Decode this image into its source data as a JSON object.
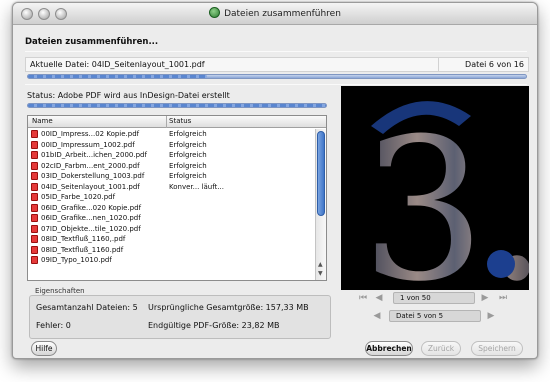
{
  "window": {
    "title": "Dateien zusammenführen"
  },
  "dialog": {
    "heading": "Dateien zusammenführen...",
    "current_file_label": "Aktuelle Datei: 04ID_Seitenlayout_1001.pdf",
    "file_counter": "Datei 6 von 16",
    "file_progress": 0.36,
    "status_text": "Status: Adobe PDF wird aus InDesign-Datei erstellt",
    "status_progress": 1.0
  },
  "list": {
    "col_name": "Name",
    "col_status": "Status",
    "items": [
      {
        "name": "00ID_Impress...02 Kopie.pdf",
        "status": "Erfolgreich"
      },
      {
        "name": "00ID_Impressum_1002.pdf",
        "status": "Erfolgreich"
      },
      {
        "name": "01bID_Arbeit...ichen_2000.pdf",
        "status": "Erfolgreich"
      },
      {
        "name": "02cID_Farbm...ent_2000.pdf",
        "status": "Erfolgreich"
      },
      {
        "name": "03ID_Dokerstellung_1003.pdf",
        "status": "Erfolgreich"
      },
      {
        "name": "04ID_Seitenlayout_1001.pdf",
        "status": "Konver... läuft..."
      },
      {
        "name": "05ID_Farbe_1020.pdf",
        "status": ""
      },
      {
        "name": "06ID_Grafike...020 Kopie.pdf",
        "status": ""
      },
      {
        "name": "06ID_Grafike...nen_1020.pdf",
        "status": ""
      },
      {
        "name": "07ID_Objekte...tile_1020.pdf",
        "status": ""
      },
      {
        "name": "08ID_Textfluß_1160,.pdf",
        "status": ""
      },
      {
        "name": "08ID_Textfluß_1160.pdf",
        "status": ""
      },
      {
        "name": "09ID_Typo_1010.pdf",
        "status": ""
      }
    ]
  },
  "properties": {
    "label": "Eigenschaften",
    "total_files": "Gesamtanzahl Dateien: 5",
    "original_size": "Ursprüngliche Gesamtgröße: 157,33 MB",
    "errors": "Fehler: 0",
    "final_size": "Endgültige PDF-Größe: 23,82 MB"
  },
  "preview": {
    "page_text": "1 von 50",
    "file_text": "Datei 5 von 5",
    "glyph": "3.",
    "colors": {
      "dark": "#0a0a0a",
      "accent": "#1c3f8f"
    }
  },
  "buttons": {
    "help": "Hilfe",
    "cancel": "Abbrechen",
    "back": "Zurück",
    "save": "Speichern"
  },
  "icons": {
    "app": "merge-icon",
    "file": "pdf-file-icon",
    "first": "first-page-icon",
    "prev": "previous-icon",
    "next": "next-icon",
    "last": "last-page-icon"
  }
}
